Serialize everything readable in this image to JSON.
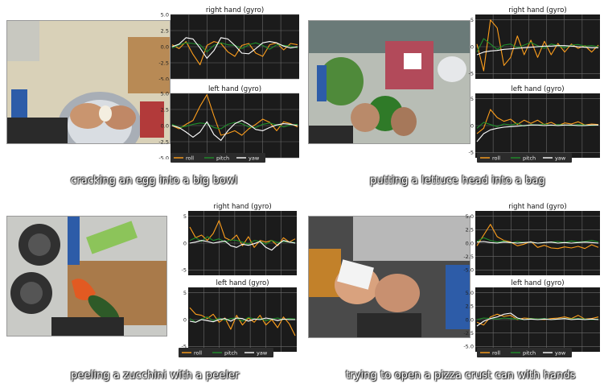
{
  "colors": {
    "roll": "#ff9f1c",
    "pitch": "#1f8f2a",
    "yaw": "#ffffff",
    "plot_bg": "#1b1b1b",
    "grid": "#6b6b6b"
  },
  "legend": {
    "roll": "roll",
    "pitch": "pitch",
    "yaw": "yaw"
  },
  "panels": [
    {
      "caption": "cracking an egg into a big bowl",
      "photo_icon": "egg-bowl-photo"
    },
    {
      "caption": "putting a lettuce head into a bag",
      "photo_icon": "lettuce-bag-photo"
    },
    {
      "caption": "peeling a zucchini with a peeler",
      "photo_icon": "zucchini-peeler-photo"
    },
    {
      "caption": "trying to open a pizza crust can with hands",
      "photo_icon": "pizza-can-photo"
    }
  ],
  "chart_data": [
    {
      "type": "line",
      "title": "right hand (gyro)",
      "ylim": [
        -5,
        5
      ],
      "yticks": [
        "5.0",
        "2.5",
        "0.0",
        "-2.5",
        "-5.0"
      ],
      "ytick_values": [
        5,
        2.5,
        0,
        -2.5,
        -5
      ],
      "grid": true,
      "series": [
        {
          "name": "roll",
          "values": [
            0.3,
            -0.3,
            0.8,
            -1.2,
            -2.8,
            0.2,
            0.8,
            0.5,
            -0.8,
            -1.5,
            0.2,
            0.5,
            -1.0,
            -1.5,
            0.3,
            0.6,
            -0.5,
            0.5,
            0.3
          ]
        },
        {
          "name": "pitch",
          "values": [
            -0.2,
            0.3,
            0.6,
            0.5,
            0.3,
            -0.8,
            0.2,
            0.6,
            0.3,
            0.2,
            -0.3,
            0.3,
            0.6,
            0.2,
            -0.4,
            0.3,
            0.2,
            0.1,
            -0.2
          ]
        },
        {
          "name": "yaw",
          "values": [
            0,
            0.4,
            1.4,
            1.2,
            -0.2,
            -1.8,
            -0.6,
            1.4,
            1.2,
            0.2,
            -1.0,
            -1.1,
            -0.3,
            0.6,
            0.8,
            0.6,
            0.1,
            -0.2,
            0
          ]
        }
      ]
    },
    {
      "type": "line",
      "title": "left hand (gyro)",
      "ylim": [
        -5,
        5
      ],
      "yticks": [
        "5.0",
        "2.5",
        "0.0",
        "-2.5",
        "-5.0"
      ],
      "ytick_values": [
        5,
        2.5,
        0,
        -2.5,
        -5
      ],
      "grid": true,
      "series": [
        {
          "name": "roll",
          "values": [
            0,
            -0.5,
            0.2,
            0.8,
            3.0,
            4.8,
            1.5,
            -1.5,
            -1.2,
            -0.8,
            -1.5,
            -0.5,
            0.2,
            1.0,
            0.5,
            -0.8,
            0.6,
            0.3,
            -0.2
          ]
        },
        {
          "name": "pitch",
          "values": [
            0.2,
            -0.3,
            -0.1,
            0.2,
            0.4,
            0.3,
            -0.3,
            -0.5,
            0.2,
            0.5,
            0.3,
            -0.2,
            -0.3,
            0.2,
            0.4,
            0.1,
            -0.2,
            0.1,
            0.2
          ]
        },
        {
          "name": "yaw",
          "values": [
            0,
            -0.3,
            -1.0,
            -1.8,
            -1.0,
            0.6,
            -1.4,
            -2.3,
            -0.8,
            0.3,
            0.8,
            0.2,
            -0.6,
            -0.8,
            -0.3,
            0.1,
            0.3,
            0.2,
            0
          ]
        }
      ]
    },
    {
      "type": "line",
      "title": "right hand (gyro)",
      "ylim": [
        -6,
        6
      ],
      "yticks": [
        "5",
        "0",
        "-5"
      ],
      "ytick_values": [
        5,
        0,
        -5
      ],
      "grid": true,
      "series": [
        {
          "name": "roll",
          "values": [
            0.5,
            -4.5,
            5.0,
            3.5,
            -3.5,
            -2.0,
            2.0,
            -1.5,
            1.2,
            -2.0,
            1.0,
            -1.5,
            0.6,
            -1.0,
            0.5,
            -0.3,
            0.2,
            -1.0,
            0.3
          ]
        },
        {
          "name": "pitch",
          "values": [
            -1.0,
            1.5,
            0.5,
            -0.5,
            0.3,
            0.5,
            -0.2,
            0.3,
            0.8,
            0.2,
            -0.3,
            0.5,
            0.2,
            -0.2,
            0.3,
            0.4,
            0.1,
            0.2,
            0
          ]
        },
        {
          "name": "yaw",
          "values": [
            -1.5,
            -1.0,
            -0.8,
            -0.7,
            -0.5,
            -0.4,
            -0.3,
            -0.2,
            -0.1,
            0,
            0.1,
            0.1,
            0.2,
            0.2,
            0.1,
            0.0,
            -0.1,
            -0.2,
            -0.2
          ]
        }
      ]
    },
    {
      "type": "line",
      "title": "left hand (gyro)",
      "ylim": [
        -6,
        6
      ],
      "yticks": [
        "5",
        "0",
        "-5"
      ],
      "ytick_values": [
        5,
        0,
        -5
      ],
      "grid": true,
      "series": [
        {
          "name": "roll",
          "values": [
            -1.5,
            -0.5,
            3.0,
            1.5,
            0.8,
            1.2,
            0.2,
            1.0,
            0.4,
            1.0,
            0.2,
            0.6,
            0.0,
            0.5,
            0.3,
            0.7,
            0.1,
            0.3,
            0.2
          ]
        },
        {
          "name": "pitch",
          "values": [
            -0.5,
            0.6,
            0.2,
            -0.2,
            0.3,
            0.1,
            0.4,
            -0.1,
            0.2,
            0.1,
            0.3,
            0.0,
            0.2,
            0.1,
            0.0,
            0.2,
            0.1,
            0.0,
            0.1
          ]
        },
        {
          "name": "yaw",
          "values": [
            -3.0,
            -1.5,
            -0.8,
            -0.5,
            -0.3,
            -0.2,
            -0.1,
            0.0,
            0.1,
            0.1,
            0.0,
            0.1,
            0.0,
            0.1,
            0.1,
            0.0,
            0.0,
            0.1,
            0.1
          ]
        }
      ]
    },
    {
      "type": "line",
      "title": "right hand (gyro)",
      "ylim": [
        -6,
        6
      ],
      "yticks": [
        "5",
        "0",
        "-5"
      ],
      "ytick_values": [
        5,
        0,
        -5
      ],
      "grid": true,
      "series": [
        {
          "name": "roll",
          "values": [
            3.0,
            1.0,
            1.5,
            0.5,
            1.8,
            4.2,
            1.0,
            0.5,
            1.5,
            -0.5,
            1.2,
            -0.8,
            0.5,
            0.2,
            0.5,
            -0.5,
            1.0,
            0.2,
            0.8
          ]
        },
        {
          "name": "pitch",
          "values": [
            0.5,
            1.0,
            0.3,
            1.2,
            0.5,
            0.8,
            0.2,
            0.6,
            0.5,
            0.2,
            -0.2,
            0.5,
            0.3,
            -0.2,
            0.5,
            0.1,
            0.3,
            0.2,
            0.1
          ]
        },
        {
          "name": "yaw",
          "values": [
            0.0,
            0.2,
            0.5,
            0.3,
            0.0,
            0.2,
            0.4,
            -0.5,
            -0.8,
            -0.2,
            -0.4,
            -0.1,
            0.3,
            -0.8,
            -1.3,
            -0.3,
            0.5,
            0.2,
            0.0
          ]
        }
      ]
    },
    {
      "type": "line",
      "title": "left hand (gyro)",
      "ylim": [
        -6,
        6
      ],
      "yticks": [
        "5",
        "0",
        "-5"
      ],
      "ytick_values": [
        5,
        0,
        -5
      ],
      "grid": true,
      "series": [
        {
          "name": "roll",
          "values": [
            2.2,
            1.0,
            0.8,
            0.2,
            1.0,
            -0.5,
            0.3,
            -1.8,
            0.8,
            -1.0,
            0.3,
            -0.5,
            0.8,
            -1.0,
            0.0,
            -1.5,
            0.5,
            -0.8,
            -3.0
          ]
        },
        {
          "name": "pitch",
          "values": [
            0.2,
            -0.5,
            0.1,
            0.5,
            -0.2,
            0.3,
            -0.1,
            0.2,
            0.3,
            -0.3,
            0.4,
            0.1,
            0.2,
            -0.2,
            0.1,
            0.3,
            0.0,
            0.2,
            0.1
          ]
        },
        {
          "name": "yaw",
          "values": [
            -0.3,
            -0.5,
            0.0,
            -0.2,
            -0.4,
            0.0,
            0.2,
            -0.3,
            0.3,
            0.2,
            -0.3,
            0.1,
            0.0,
            0.3,
            0.1,
            -0.2,
            0.1,
            0.0,
            0.0
          ]
        }
      ]
    },
    {
      "type": "line",
      "title": "right hand (gyro)",
      "ylim": [
        -6,
        6
      ],
      "yticks": [
        "5.0",
        "2.5",
        "0.0",
        "-2.5",
        "-5.0"
      ],
      "ytick_values": [
        5,
        2.5,
        0,
        -2.5,
        -5
      ],
      "grid": true,
      "series": [
        {
          "name": "roll",
          "values": [
            -0.5,
            1.5,
            3.5,
            1.2,
            0.5,
            0.2,
            -0.5,
            -0.2,
            0.3,
            -0.8,
            -0.4,
            -0.9,
            -1.0,
            -0.7,
            -0.9,
            -0.6,
            -1.0,
            -0.3,
            -0.8
          ]
        },
        {
          "name": "pitch",
          "values": [
            0.3,
            1.0,
            0.5,
            0.2,
            0.4,
            0.0,
            0.3,
            0.1,
            0.2,
            0.0,
            0.1,
            0.2,
            0.3,
            0.1,
            0.4,
            0.2,
            0.3,
            0.5,
            0.2
          ]
        },
        {
          "name": "yaw",
          "values": [
            0.2,
            0.3,
            0.1,
            0.0,
            0.2,
            0.1,
            0.0,
            0.1,
            0.2,
            0.0,
            0.1,
            0.2,
            0.0,
            0.1,
            0.0,
            0.1,
            0.2,
            0.1,
            0.0
          ]
        }
      ]
    },
    {
      "type": "line",
      "title": "left hand (gyro)",
      "ylim": [
        -6,
        6
      ],
      "yticks": [
        "5.0",
        "2.5",
        "0.0",
        "-2.5",
        "-5.0"
      ],
      "ytick_values": [
        5,
        2.5,
        0,
        -2.5,
        -5
      ],
      "grid": true,
      "series": [
        {
          "name": "roll",
          "values": [
            -0.5,
            -1.0,
            0.5,
            1.0,
            0.6,
            0.8,
            0.0,
            0.3,
            0.2,
            0.1,
            0.0,
            0.2,
            0.3,
            0.5,
            0.2,
            0.8,
            0.1,
            0.2,
            0.5
          ]
        },
        {
          "name": "pitch",
          "values": [
            0.0,
            0.3,
            0.2,
            0.1,
            0.3,
            0.2,
            0.1,
            0.0,
            0.2,
            0.1,
            0.2,
            0.0,
            0.1,
            0.2,
            0.1,
            0.2,
            0.1,
            0.0,
            0.1
          ]
        },
        {
          "name": "yaw",
          "values": [
            -1.2,
            -0.3,
            0.2,
            0.5,
            1.0,
            1.2,
            0.3,
            0.0,
            0.1,
            0.0,
            0.1,
            0.0,
            0.1,
            0.2,
            0.0,
            0.1,
            0.0,
            0.1,
            0.0
          ]
        }
      ]
    }
  ]
}
